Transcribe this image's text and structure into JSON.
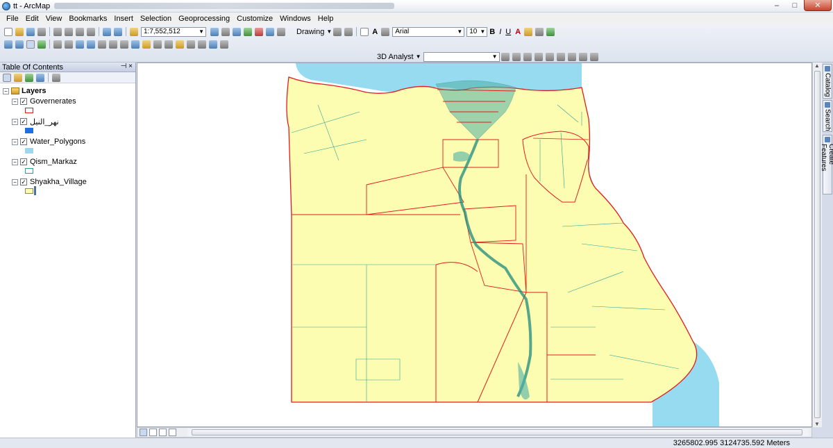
{
  "window": {
    "title": "tt - ArcMap"
  },
  "menu": [
    "File",
    "Edit",
    "View",
    "Bookmarks",
    "Insert",
    "Selection",
    "Geoprocessing",
    "Customize",
    "Windows",
    "Help"
  ],
  "toolbar": {
    "scale": "1:7,552,512",
    "drawing_label": "Drawing",
    "font_name": "Arial",
    "font_size": "10",
    "bold": "B",
    "italic": "I",
    "underline": "U",
    "text_tool": "A",
    "font_color_glyph": "A",
    "analyst_label": "3D Analyst"
  },
  "toc": {
    "title": "Table Of Contents",
    "pin_glyph": "⊣ ×",
    "root": "Layers",
    "layers": [
      {
        "name": "Governerates",
        "symbol": "outline",
        "color": "#e31a1c"
      },
      {
        "name": "نهر_النيل",
        "symbol": "fill",
        "color": "#1f6fe0"
      },
      {
        "name": "Water_Polygons",
        "symbol": "fill",
        "color": "#9fd6ee"
      },
      {
        "name": "Qism_Markaz",
        "symbol": "outline",
        "color": "#2aa198"
      },
      {
        "name": "Shyakha_Village",
        "symbol": "fill",
        "color": "#fdfdb1"
      }
    ]
  },
  "map": {
    "water_color": "#97dbf0",
    "land_color": "#fdfdb1",
    "gov_border_color": "#e31a1c",
    "district_color": "#2aa198"
  },
  "side_tabs": [
    "Catalog",
    "Search",
    "Create Features"
  ],
  "status": {
    "coords": "3265802.995  3124735.592 Meters"
  }
}
